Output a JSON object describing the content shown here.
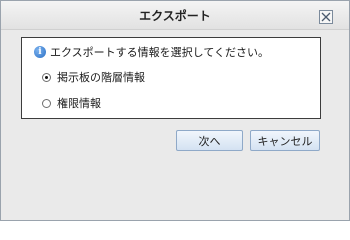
{
  "dialog": {
    "title": "エクスポート",
    "close_icon": "close-icon",
    "prompt": "エクスポートする情報を選択してください。",
    "info_icon": "info-icon",
    "options": [
      {
        "label": "掲示板の階層情報",
        "selected": true
      },
      {
        "label": "権限情報",
        "selected": false
      }
    ],
    "buttons": {
      "next": "次へ",
      "cancel": "キャンセル"
    }
  }
}
